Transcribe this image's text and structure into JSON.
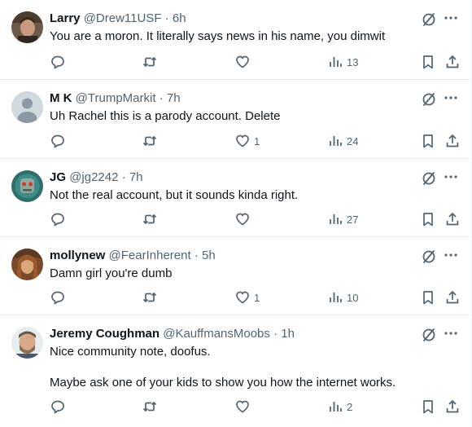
{
  "tweets": [
    {
      "name": "Larry",
      "handle": "@Drew11USF",
      "dot": "·",
      "time": "6h",
      "lines": [
        "You are a moron. It literally says news in his name, you dimwit"
      ],
      "likes": "",
      "views": "13"
    },
    {
      "name": "M K",
      "handle": "@TrumpMarkit",
      "dot": "·",
      "time": "7h",
      "lines": [
        "Uh Rachel this is a parody account. Delete"
      ],
      "likes": "1",
      "views": "24"
    },
    {
      "name": "JG",
      "handle": "@jg2242",
      "dot": "·",
      "time": "7h",
      "lines": [
        "Not the real account, but it sounds kinda right."
      ],
      "likes": "",
      "views": "27"
    },
    {
      "name": "mollynew",
      "handle": "@FearInherent",
      "dot": "·",
      "time": "5h",
      "lines": [
        "Damn girl you're dumb"
      ],
      "likes": "1",
      "views": "10"
    },
    {
      "name": "Jeremy Coughman",
      "handle": "@KauffmansMoobs",
      "dot": "·",
      "time": "1h",
      "lines": [
        "Nice community note, doofus.",
        "Maybe ask one of your kids to show you how the internet works."
      ],
      "likes": "",
      "views": "2"
    }
  ],
  "colors": {
    "text": "#0f1419",
    "secondary": "#536471",
    "divider": "#e6ecf0"
  },
  "icons": {
    "reply": "reply-icon",
    "retweet": "retweet-icon",
    "like": "like-icon",
    "views": "views-icon",
    "bookmark": "bookmark-icon",
    "share": "share-icon",
    "grok": "grok-icon",
    "more": "more-icon"
  }
}
